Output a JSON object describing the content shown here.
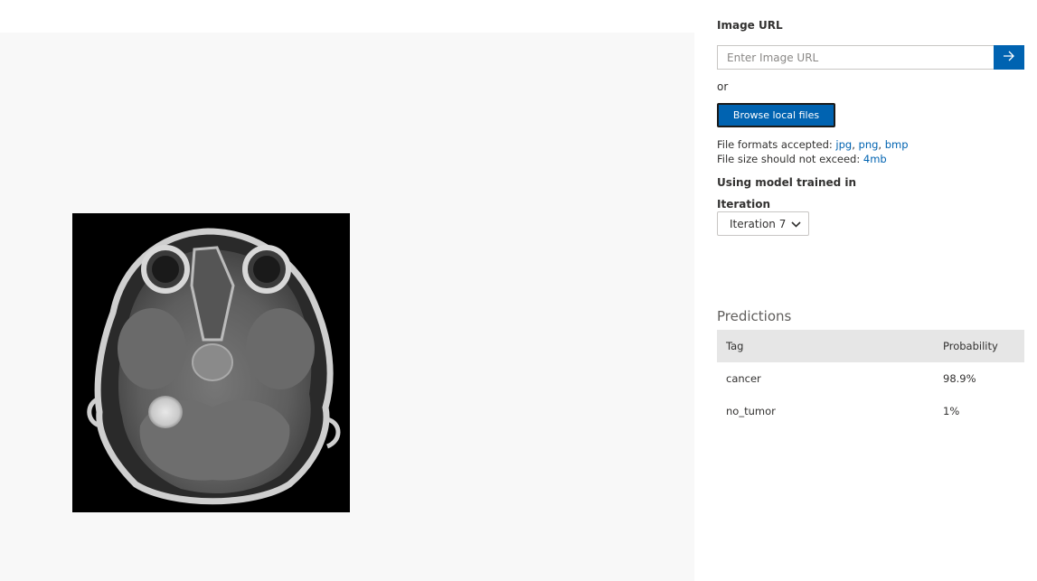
{
  "image_url": {
    "label": "Image URL",
    "placeholder": "Enter Image URL",
    "submit_icon": "arrow-right-icon"
  },
  "or_text": "or",
  "browse_button": "Browse local files",
  "formats": {
    "prefix": "File formats accepted: ",
    "types": [
      "jpg",
      "png",
      "bmp"
    ]
  },
  "size": {
    "prefix": "File size should not exceed: ",
    "limit": "4mb"
  },
  "model": {
    "heading": "Using model trained in",
    "iteration_label": "Iteration",
    "selected_iteration": "Iteration 7"
  },
  "predictions": {
    "title": "Predictions",
    "headers": {
      "tag": "Tag",
      "probability": "Probability"
    },
    "rows": [
      {
        "tag": "cancer",
        "probability": "98.9%"
      },
      {
        "tag": "no_tumor",
        "probability": "1%"
      }
    ]
  },
  "colors": {
    "accent": "#0063b1",
    "preview_bg": "#f8f8f8",
    "table_header_bg": "#e6e6e6"
  }
}
